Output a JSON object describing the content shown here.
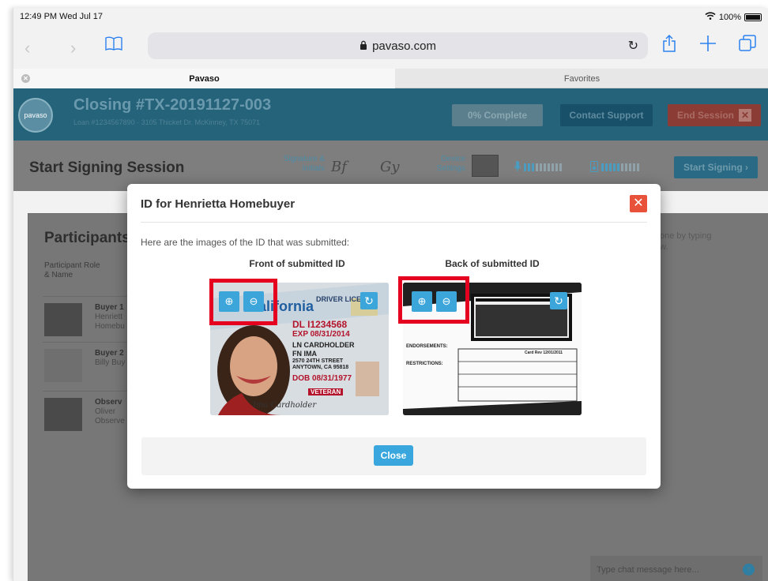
{
  "status_bar": {
    "time": "12:49 PM  Wed Jul 17",
    "battery": "100%"
  },
  "browser": {
    "url": "pavaso.com",
    "tabs": [
      {
        "label": "Pavaso"
      },
      {
        "label": "Favorites"
      }
    ]
  },
  "app": {
    "logo_text": "pavaso",
    "closing_title": "Closing #TX-20191127-003",
    "closing_subtitle": "Loan #1234567890  ·  3105 Thicket Dr. McKinney, TX 75071",
    "complete_label": "0% Complete",
    "contact_support_label": "Contact Support",
    "end_session_label": "End Session",
    "end_session_x": "✕",
    "section_title": "Start Signing Session",
    "signature_label": "Signature & Initials",
    "signature_sample": "Bf",
    "initials_sample": "Gy",
    "device_label": "Device Settings",
    "start_signing_label": "Start Signing ›"
  },
  "participants": {
    "title": "Participants",
    "column_header": "Participant Role & Name",
    "rows": [
      {
        "role": "Buyer 1",
        "name_line1": "Henriett",
        "name_line2": "Homebu"
      },
      {
        "role": "Buyer 2",
        "name_line1": "Billy Buy",
        "name_line2": ""
      },
      {
        "role": "Observ",
        "name_line1": "Oliver",
        "name_line2": "Observe"
      }
    ]
  },
  "chat": {
    "hint_line1": "one by typing",
    "hint_line2": "w.",
    "input_placeholder": "Type chat message here..."
  },
  "modal": {
    "title": "ID for Henrietta Homebuyer",
    "close_icon": "✕",
    "description": "Here are the images of the ID that was submitted:",
    "front_title": "Front of submitted ID",
    "back_title": "Back of submitted ID",
    "close_button": "Close",
    "front_card": {
      "state": "California",
      "type": "DRIVER LICENSE",
      "dl": "DL I1234568",
      "exp": "EXP 08/31/2014",
      "ln": "LN CARDHOLDER",
      "fn": "FN IMA",
      "addr1": "2570 24TH STREET",
      "addr2": "ANYTOWN, CA 95818",
      "dob": "DOB 08/31/1977",
      "veteran": "VETERAN",
      "signature": "Ima Cardholder"
    },
    "back_card": {
      "endorsements": "ENDORSEMENTS:",
      "restrictions": "RESTRICTIONS:",
      "card_rev": "Card Rev 12/01/2011"
    }
  },
  "colors": {
    "highlight": "#e5001f",
    "zoom_button": "#3ca6db",
    "modal_close": "#e8513a"
  }
}
